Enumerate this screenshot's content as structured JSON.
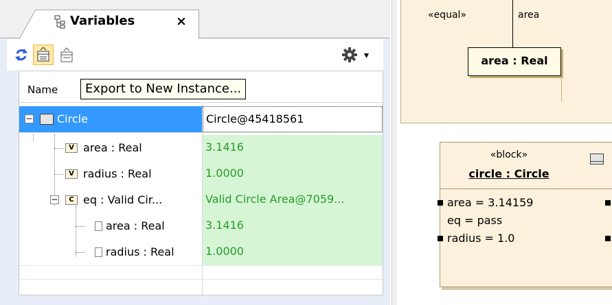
{
  "panel": {
    "tab_title": "Variables",
    "tab_close": "×",
    "toolbar": {
      "refresh_icon": "refresh-icon",
      "export_icon": "export-instance-icon",
      "export2_icon": "export-icon",
      "gear_icon": "gear-icon",
      "menu_glyph": "▾"
    },
    "grid": {
      "column_name": "Name",
      "tooltip": "Export to New Instance...",
      "rows": [
        {
          "name": "Circle",
          "value": "Circle@45418561",
          "selected": true
        },
        {
          "name": "area : Real",
          "value": "3.1416"
        },
        {
          "name": "radius : Real",
          "value": "1.0000"
        },
        {
          "name": "eq : Valid Cir...",
          "value": "Valid Circle Area@7059..."
        },
        {
          "name": "area : Real",
          "value": "3.1416"
        },
        {
          "name": "radius : Real",
          "value": "1.0000"
        }
      ]
    }
  },
  "diagram": {
    "top": {
      "stereotype": "«equal»",
      "connector_label": "area",
      "part": "area : Real"
    },
    "block": {
      "stereotype": "«block»",
      "title": "circle : Circle",
      "slots": [
        "area = 3.14159",
        "eq = pass",
        "radius = 1.0"
      ]
    }
  },
  "colors": {
    "selection": "#3399ff",
    "value_bg": "#d5f5d5",
    "value_text": "#2a9a2a",
    "diagram_bg": "#fbf1dc"
  }
}
